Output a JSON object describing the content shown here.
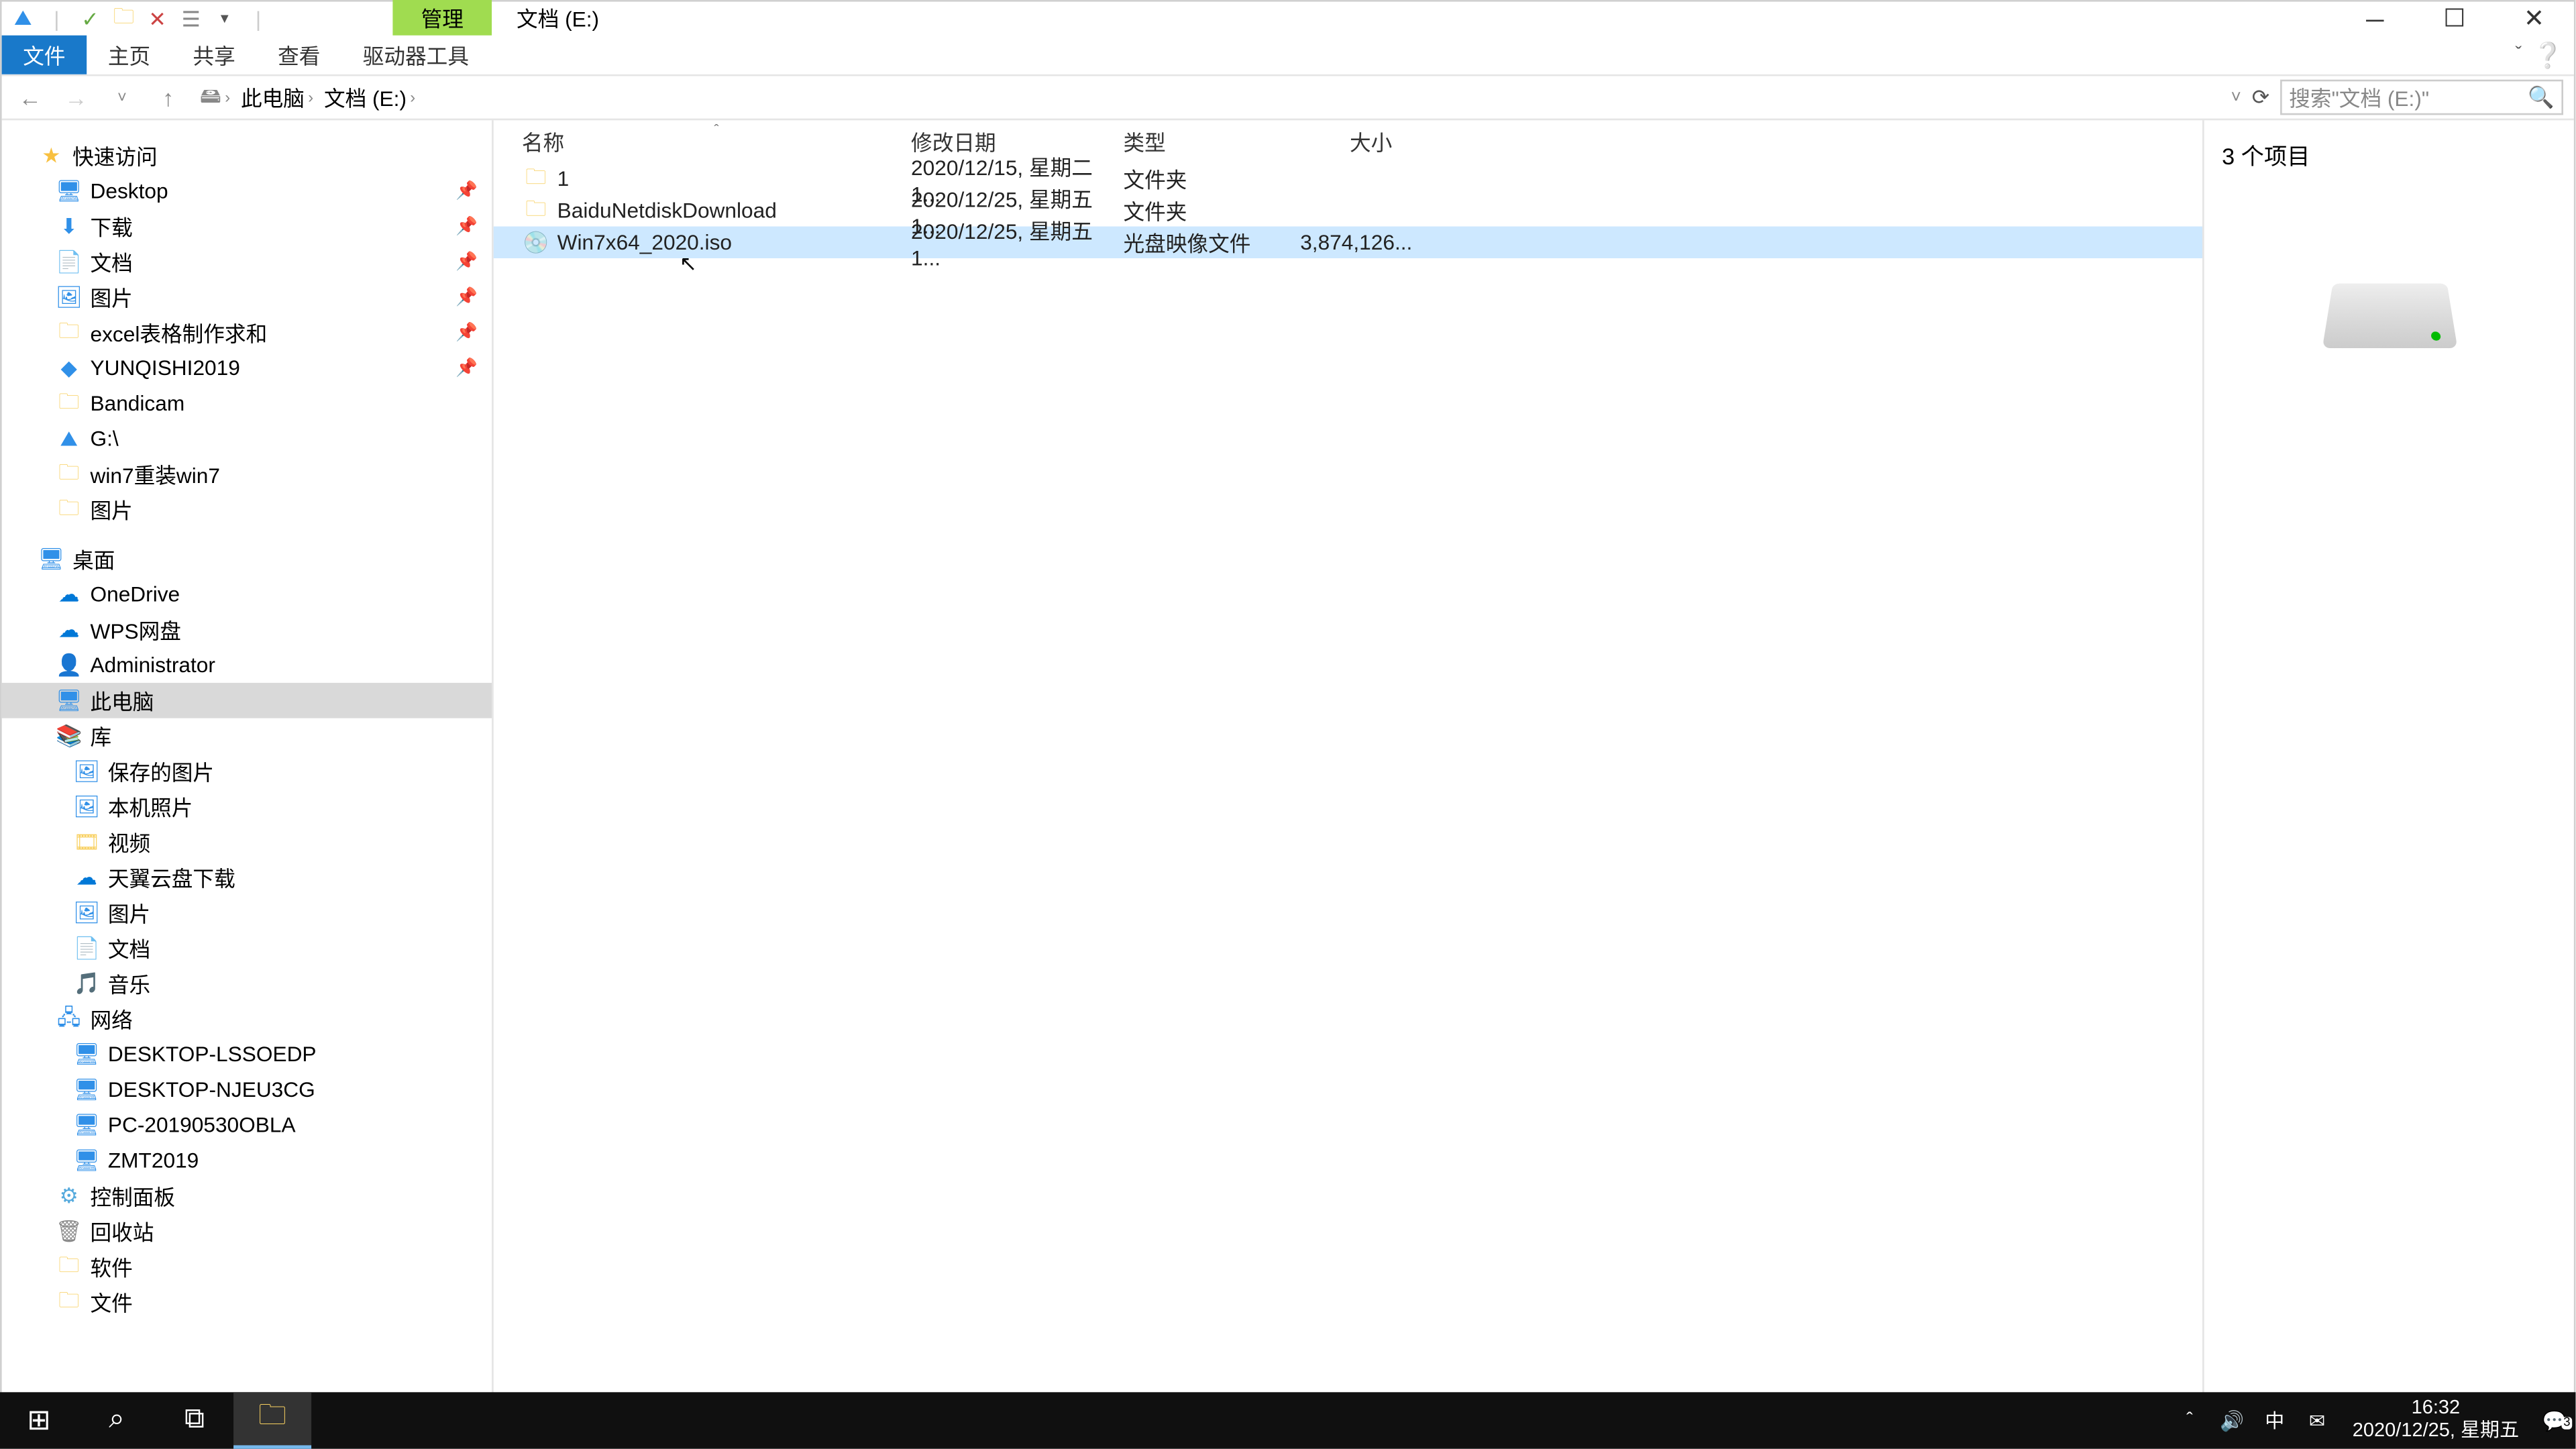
{
  "titlebar": {
    "context_tab": "管理",
    "location": "文档 (E:)"
  },
  "ribbon": {
    "file": "文件",
    "home": "主页",
    "share": "共享",
    "view": "查看",
    "drive_tools": "驱动器工具"
  },
  "address": {
    "seg1": "此电脑",
    "seg2": "文档 (E:)"
  },
  "search": {
    "placeholder": "搜索\"文档 (E:)\""
  },
  "nav": {
    "quick_access": "快速访问",
    "desktop": "Desktop",
    "downloads": "下载",
    "documents": "文档",
    "pictures1": "图片",
    "excel": "excel表格制作求和",
    "yunqishi": "YUNQISHI2019",
    "bandicam": "Bandicam",
    "gdrive": "G:\\",
    "win7": "win7重装win7",
    "pictures2": "图片",
    "desktop2": "桌面",
    "onedrive": "OneDrive",
    "wps": "WPS网盘",
    "admin": "Administrator",
    "thispc": "此电脑",
    "library": "库",
    "saved_pics": "保存的图片",
    "local_photos": "本机照片",
    "videos": "视频",
    "tianyi": "天翼云盘下载",
    "pictures3": "图片",
    "documents2": "文档",
    "music": "音乐",
    "network": "网络",
    "pc1": "DESKTOP-LSSOEDP",
    "pc2": "DESKTOP-NJEU3CG",
    "pc3": "PC-20190530OBLA",
    "pc4": "ZMT2019",
    "control_panel": "控制面板",
    "recycle": "回收站",
    "software": "软件",
    "files": "文件"
  },
  "columns": {
    "name": "名称",
    "date": "修改日期",
    "type": "类型",
    "size": "大小"
  },
  "files": [
    {
      "name": "1",
      "date": "2020/12/15, 星期二 1...",
      "type": "文件夹",
      "size": "",
      "icon": "folder"
    },
    {
      "name": "BaiduNetdiskDownload",
      "date": "2020/12/25, 星期五 1...",
      "type": "文件夹",
      "size": "",
      "icon": "folder"
    },
    {
      "name": "Win7x64_2020.iso",
      "date": "2020/12/25, 星期五 1...",
      "type": "光盘映像文件",
      "size": "3,874,126...",
      "icon": "iso"
    }
  ],
  "preview": {
    "count": "3 个项目"
  },
  "status": {
    "text": "3 个项目"
  },
  "taskbar": {
    "time": "16:32",
    "date": "2020/12/25, 星期五",
    "ime": "中",
    "notif_badge": "3"
  }
}
